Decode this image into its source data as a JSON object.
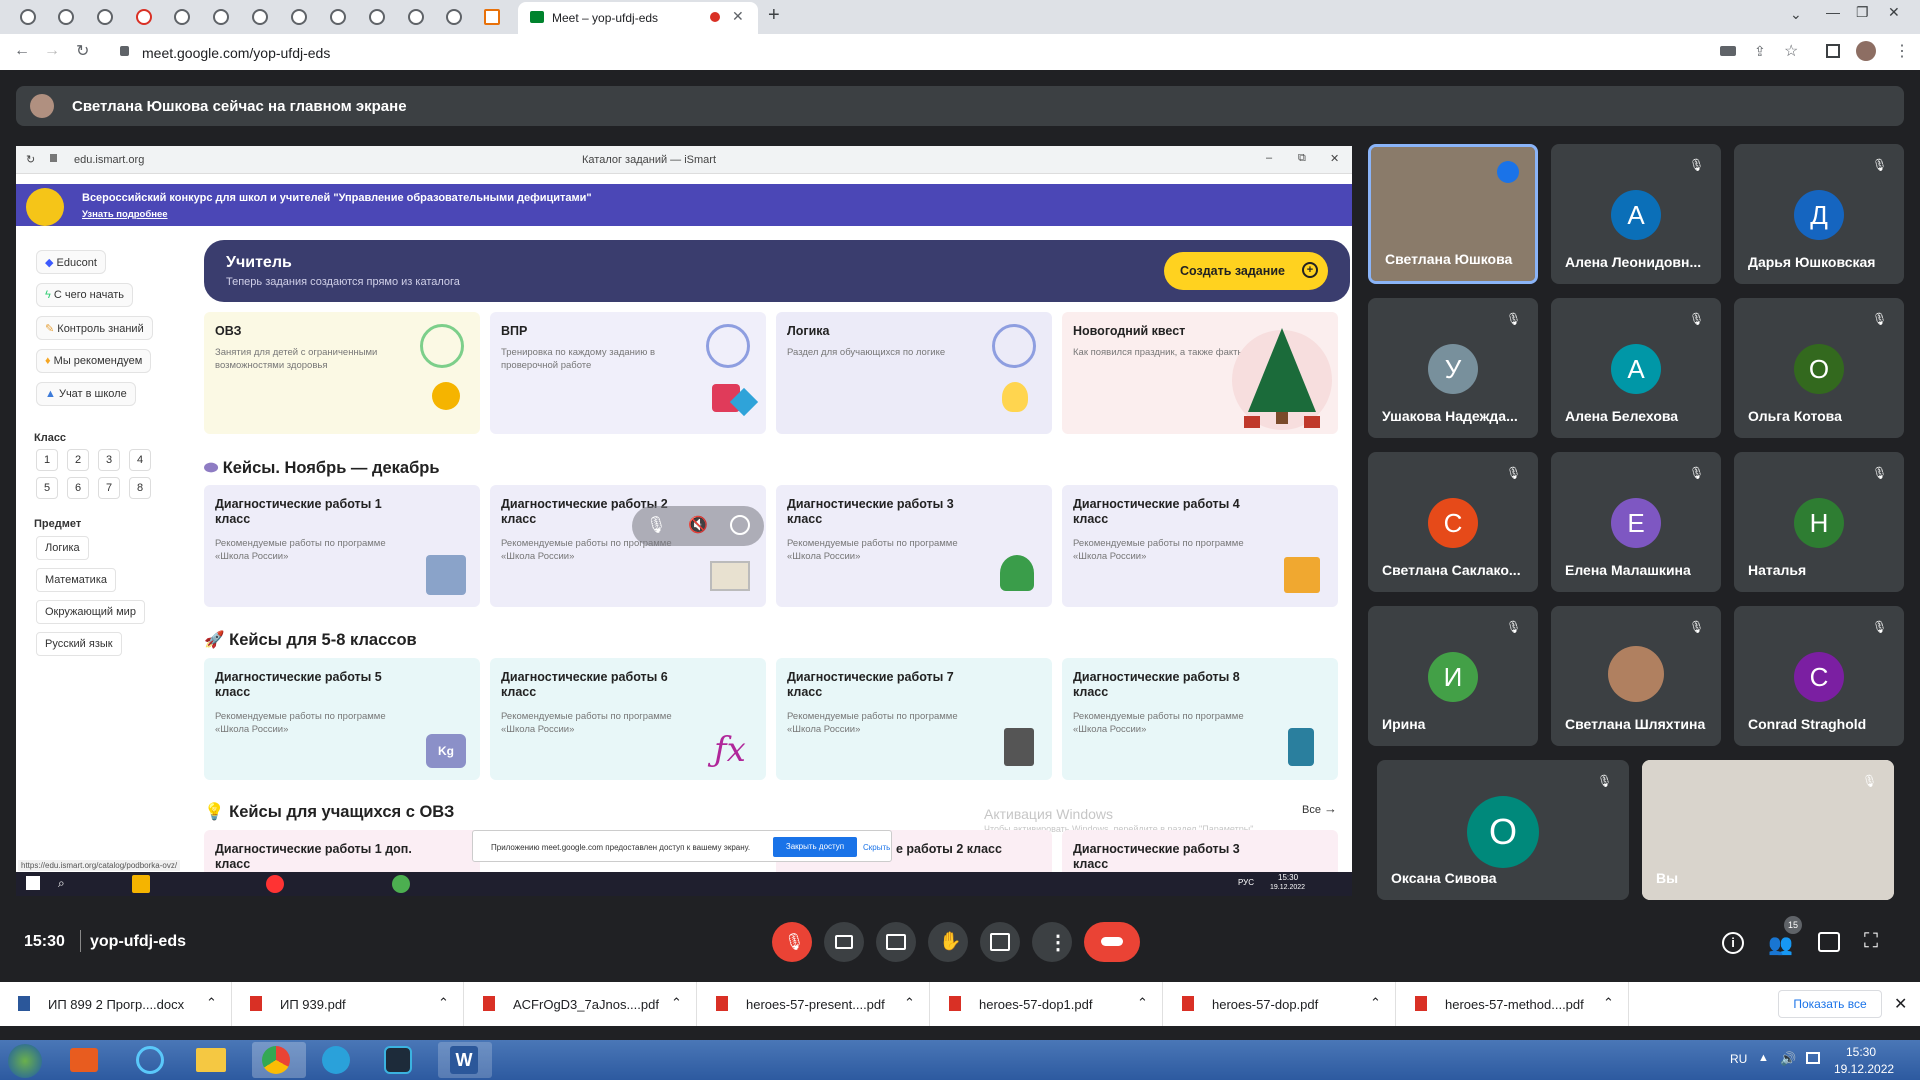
{
  "browser": {
    "active_tab_title": "Meet – yop-ufdj-eds",
    "url": "meet.google.com/yop-ufdj-eds"
  },
  "meet": {
    "presenting_banner": "Светлана Юшкова сейчас на главном экране",
    "time": "15:30",
    "meeting_code": "yop-ufdj-eds",
    "participants_badge": "15",
    "tiles": [
      {
        "name": "Светлана Юшкова",
        "letter": "",
        "color": "#8a7b6a",
        "speaking": true
      },
      {
        "name": "Алена Леонидовн...",
        "letter": "А",
        "color": "#0b6fb8"
      },
      {
        "name": "Дарья Юшковская",
        "letter": "Д",
        "color": "#1565c0"
      },
      {
        "name": "Ушакова Надежда...",
        "letter": "У",
        "color": "#78909c"
      },
      {
        "name": "Алена Белехова",
        "letter": "А",
        "color": "#0097a7"
      },
      {
        "name": "Ольга Котова",
        "letter": "О",
        "color": "#33691e"
      },
      {
        "name": "Светлана Саклако...",
        "letter": "С",
        "color": "#e64a19"
      },
      {
        "name": "Елена Малашкина",
        "letter": "Е",
        "color": "#7e57c2"
      },
      {
        "name": "Наталья",
        "letter": "Н",
        "color": "#2e7d32"
      },
      {
        "name": "Ирина",
        "letter": "И",
        "color": "#43a047"
      },
      {
        "name": "Светлана Шляхтина",
        "letter": "",
        "color": "#b08060"
      },
      {
        "name": "Conrad Straghold",
        "letter": "C",
        "color": "#7b1fa2"
      },
      {
        "name": "Оксана Сивова",
        "letter": "О",
        "color": "#00897b"
      },
      {
        "name": "Вы",
        "letter": "",
        "color": "#d9d4cc"
      }
    ]
  },
  "shared": {
    "win_url": "edu.ismart.org",
    "win_title": "Каталог заданий — iSmart",
    "banner_title": "Всероссийский конкурс для школ и учителей \"Управление образовательными дефицитами\"",
    "banner_link": "Узнать подробнее",
    "side_items": [
      "Educont",
      "С чего начать",
      "Контроль знаний",
      "Мы рекомендуем",
      "Учат в школе"
    ],
    "grade_label": "Класс",
    "grades": [
      "1",
      "2",
      "3",
      "4",
      "5",
      "6",
      "7",
      "8"
    ],
    "subject_label": "Предмет",
    "subjects": [
      "Логика",
      "Математика",
      "Окружающий мир",
      "Русский язык"
    ],
    "hero_title": "Учитель",
    "hero_sub": "Теперь задания создаются прямо из каталога",
    "hero_button": "Создать задание",
    "top_cards": [
      {
        "title": "ОВЗ",
        "desc": "Занятия для детей с ограниченными возможностями здоровья",
        "bg": "#fbf9e4"
      },
      {
        "title": "ВПР",
        "desc": "Тренировка по каждому заданию в проверочной работе",
        "bg": "#f0effa"
      },
      {
        "title": "Логика",
        "desc": "Раздел для обучающихся по логике",
        "bg": "#ecebf8"
      },
      {
        "title": "Новогодний квест",
        "desc": "Как появился праздник, а также факты",
        "bg": "#fbeeee"
      }
    ],
    "section1": "Кейсы. Ноябрь — декабрь",
    "section1_cards": [
      {
        "title": "Диагностические работы 1 класс",
        "desc": "Рекомендуемые работы по программе «Школа России»"
      },
      {
        "title": "Диагностические работы 2 класс",
        "desc": "Рекомендуемые работы по программе «Школа России»"
      },
      {
        "title": "Диагностические работы 3 класс",
        "desc": "Рекомендуемые работы по программе «Школа России»"
      },
      {
        "title": "Диагностические работы 4 класс",
        "desc": "Рекомендуемые работы по программе «Школа России»"
      }
    ],
    "section2": "Кейсы для 5-8 классов",
    "section2_cards": [
      {
        "title": "Диагностические работы 5 класс",
        "desc": "Рекомендуемые работы по программе «Школа России»"
      },
      {
        "title": "Диагностические работы 6 класс",
        "desc": "Рекомендуемые работы по программе «Школа России»"
      },
      {
        "title": "Диагностические работы 7 класс",
        "desc": "Рекомендуемые работы по программе «Школа России»"
      },
      {
        "title": "Диагностические работы 8 класс",
        "desc": "Рекомендуемые работы по программе «Школа России»"
      }
    ],
    "section3": "Кейсы для учащихся с ОВЗ",
    "section3_all": "Все",
    "section3_cards": [
      {
        "title": "Диагностические работы 1 доп. класс"
      },
      {
        "title": "е работы 2 класс"
      },
      {
        "title": "Диагностические работы 3 класс"
      }
    ],
    "watermark1": "Активация Windows",
    "watermark2": "Чтобы активировать Windows, перейдите в раздел \"Параметры\".",
    "share_msg": "Приложению meet.google.com предоставлен доступ к вашему экрану.",
    "share_stop": "Закрыть доступ",
    "share_hide": "Скрыть",
    "status_url": "https://edu.ismart.org/catalog/podborka-ovz/",
    "inner_clock": "15:30",
    "inner_date": "19.12.2022",
    "inner_lang": "РУС"
  },
  "downloads": {
    "items": [
      "ИП 899 2 Прогр....docx",
      "ИП 939.pdf",
      "ACFrOgD3_7aJnos....pdf",
      "heroes-57-present....pdf",
      "heroes-57-dop1.pdf",
      "heroes-57-dop.pdf",
      "heroes-57-method....pdf"
    ],
    "show_all": "Показать все"
  },
  "taskbar": {
    "lang": "RU",
    "time": "15:30",
    "date": "19.12.2022"
  }
}
